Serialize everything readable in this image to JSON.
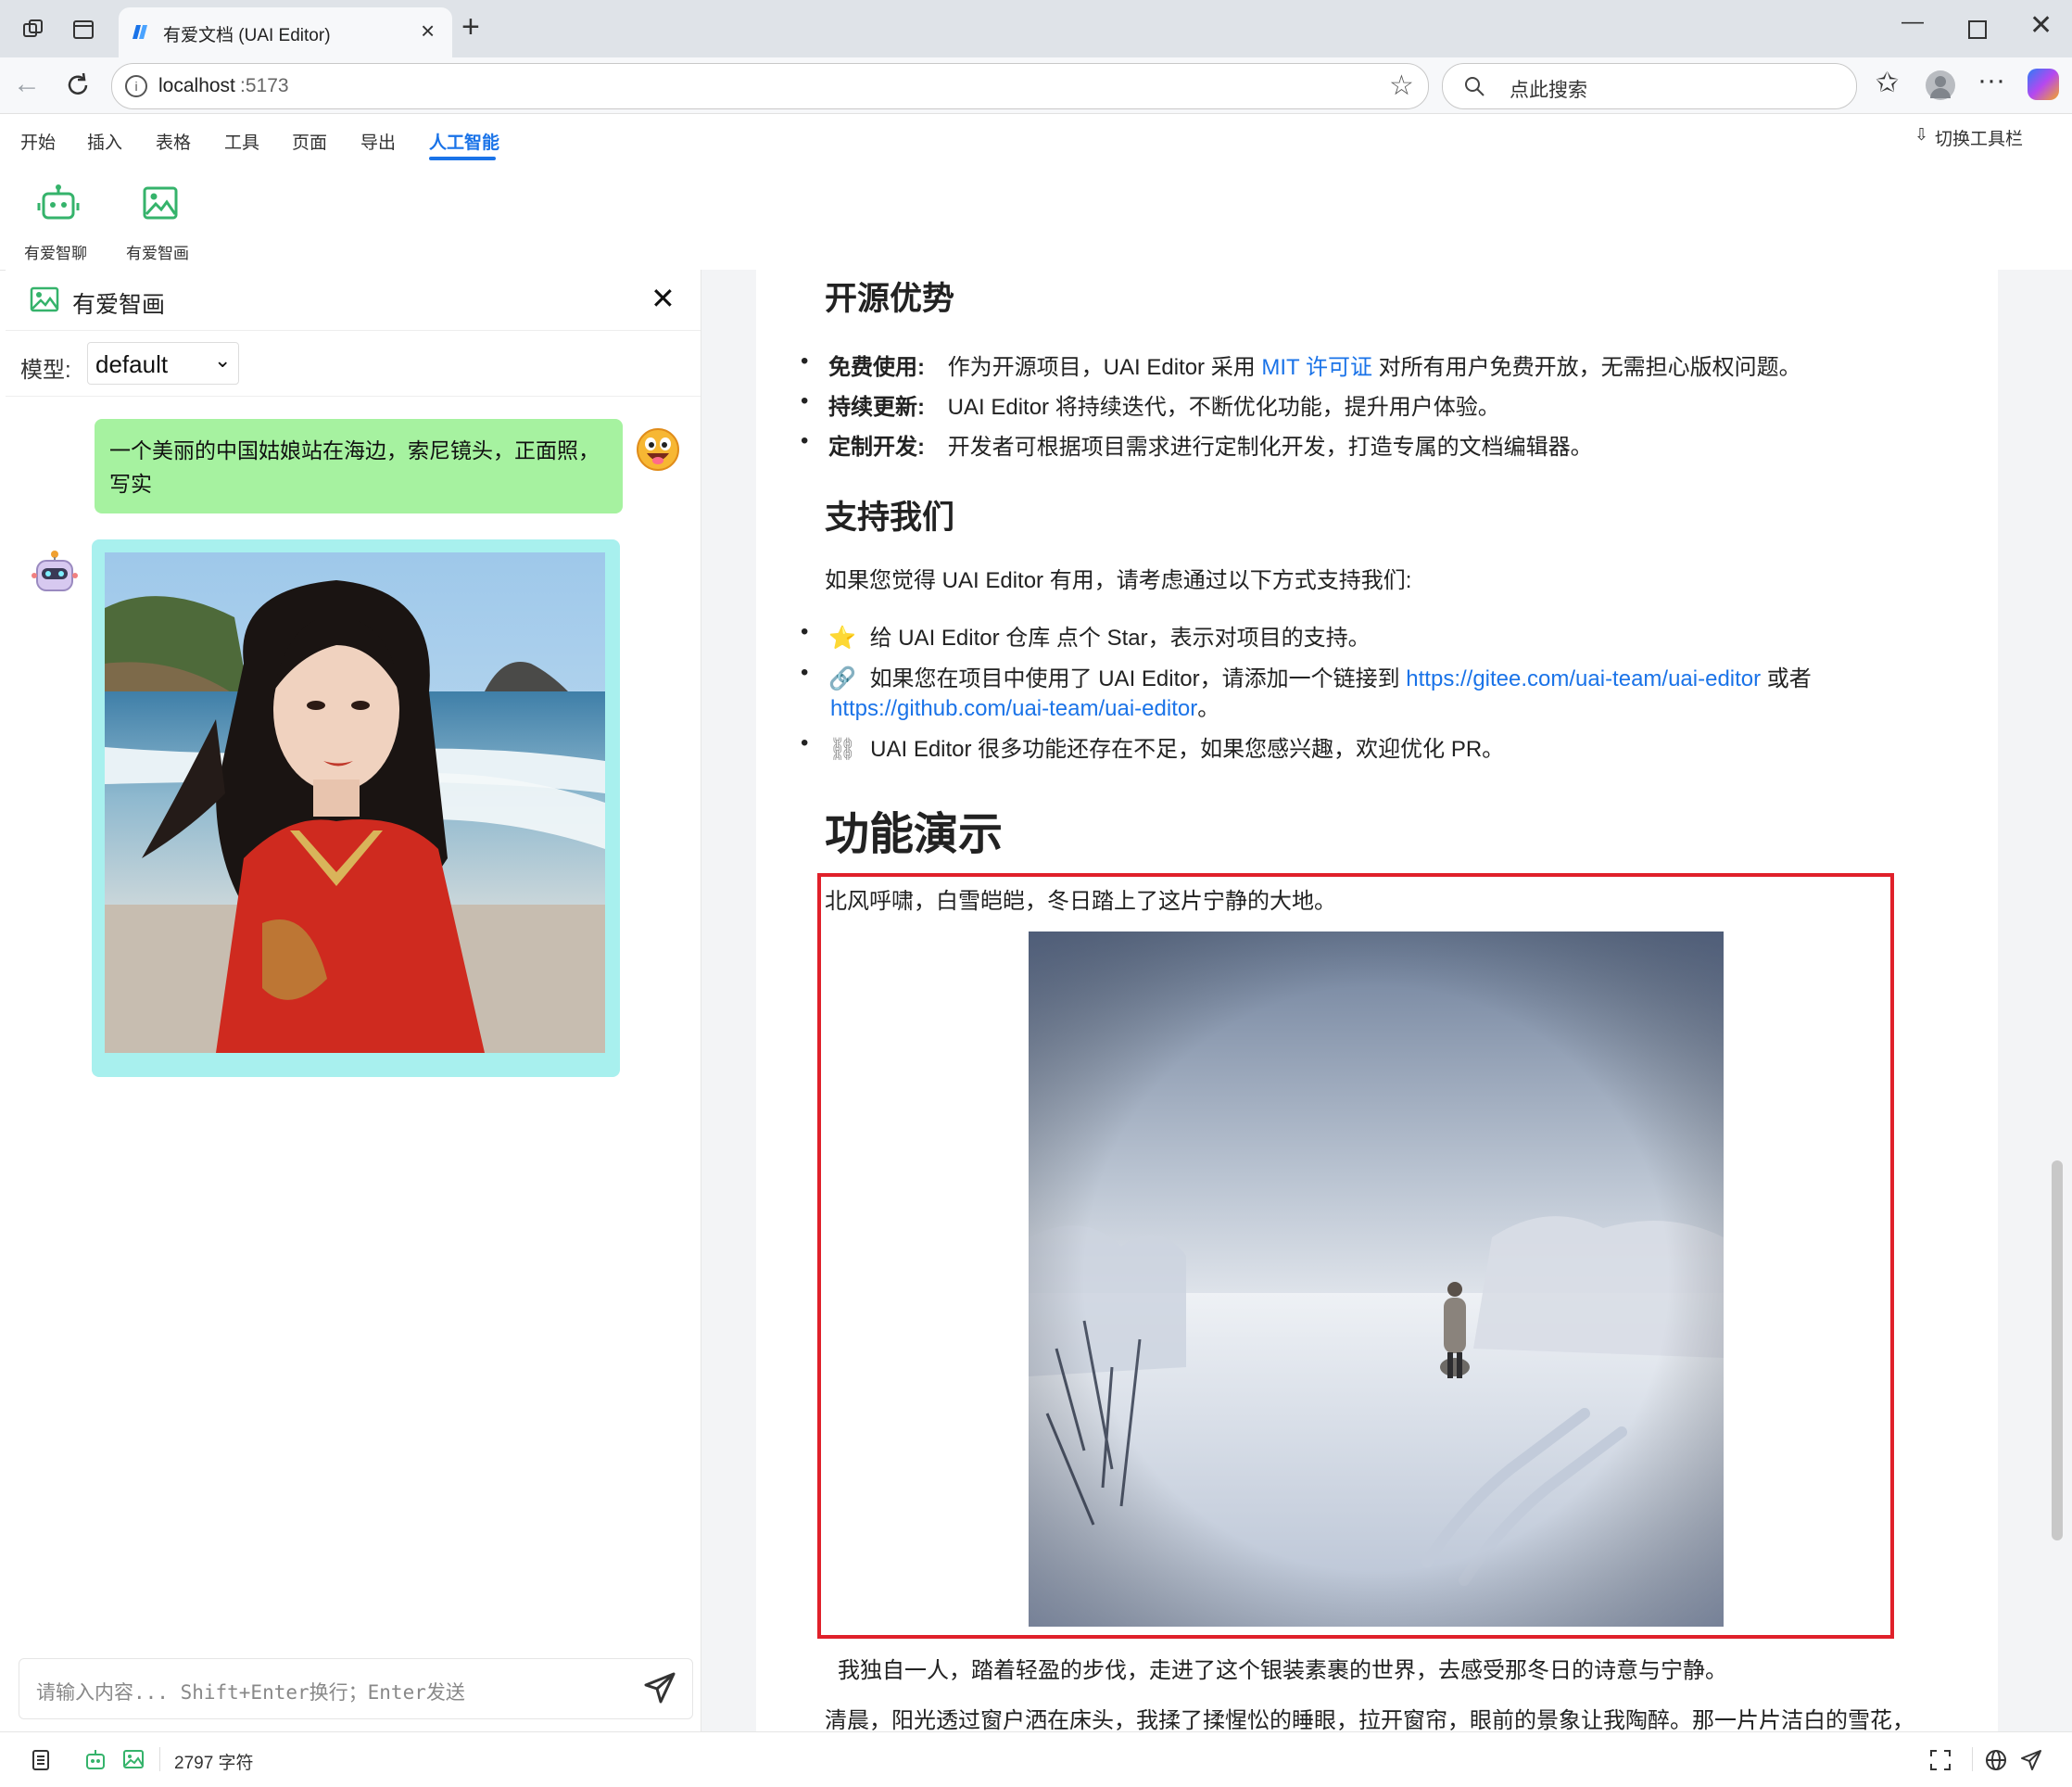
{
  "browser": {
    "tab_title": "有爱文档 (UAI Editor)",
    "url_host": "localhost",
    "url_port": ":5173",
    "search_placeholder": "点此搜索"
  },
  "menubar": {
    "items": [
      "开始",
      "插入",
      "表格",
      "工具",
      "页面",
      "导出",
      "人工智能"
    ],
    "active": "人工智能",
    "toggle_toolbar": "切换工具栏"
  },
  "ribbon": {
    "chat_label": "有爱智聊",
    "draw_label": "有爱智画"
  },
  "panel": {
    "title": "有爱智画",
    "model_label": "模型:",
    "model_value": "default",
    "user_message": "一个美丽的中国姑娘站在海边，索尼镜头，正面照，写实",
    "input_placeholder": "请输入内容... Shift+Enter换行；Enter发送"
  },
  "document": {
    "h_open_source": "开源优势",
    "open_items": [
      {
        "bold": "免费使用:",
        "text_before": "作为开源项目，UAI Editor 采用 ",
        "link": "MIT 许可证",
        "text_after": " 对所有用户免费开放，无需担心版权问题。"
      },
      {
        "bold": "持续更新:",
        "text": "UAI Editor 将持续迭代，不断优化功能，提升用户体验。"
      },
      {
        "bold": "定制开发:",
        "text": "开发者可根据项目需求进行定制化开发，打造专属的文档编辑器。"
      }
    ],
    "h_support": "支持我们",
    "support_intro": "如果您觉得 UAI Editor 有用，请考虑通过以下方式支持我们:",
    "support_items": [
      {
        "emoji": "⭐",
        "text": "给 UAI Editor 仓库 点个 Star，表示对项目的支持。"
      },
      {
        "emoji": "🔗",
        "text": "如果您在项目中使用了 UAI Editor，请添加一个链接到 ",
        "link1": "https://gitee.com/uai-team/uai-editor",
        "mid": " 或者",
        "link2": "https://github.com/uai-team/uai-editor",
        "end": "。"
      },
      {
        "emoji": "⛓",
        "text": "UAI Editor 很多功能还存在不足，如果您感兴趣，欢迎优化 PR。"
      }
    ],
    "h_demo": "功能演示",
    "demo_line1": "北风呼啸，白雪皑皑，冬日踏上了这片宁静的大地。",
    "demo_line2": "我独自一人，踏着轻盈的步伐，走进了这个银装素裹的世界，去感受那冬日的诗意与宁静。",
    "demo_line3": "清晨，阳光透过窗户洒在床头，我揉了揉惺忪的睡眼，拉开窗帘，眼前的景象让我陶醉。那一片片洁白的雪花，"
  },
  "status": {
    "char_count": "2797 字符"
  },
  "colors": {
    "accent": "#1a73e8",
    "user_bubble": "#a6f2a0",
    "ai_bubble": "#a8f0ee",
    "highlight_border": "#e0202a"
  }
}
